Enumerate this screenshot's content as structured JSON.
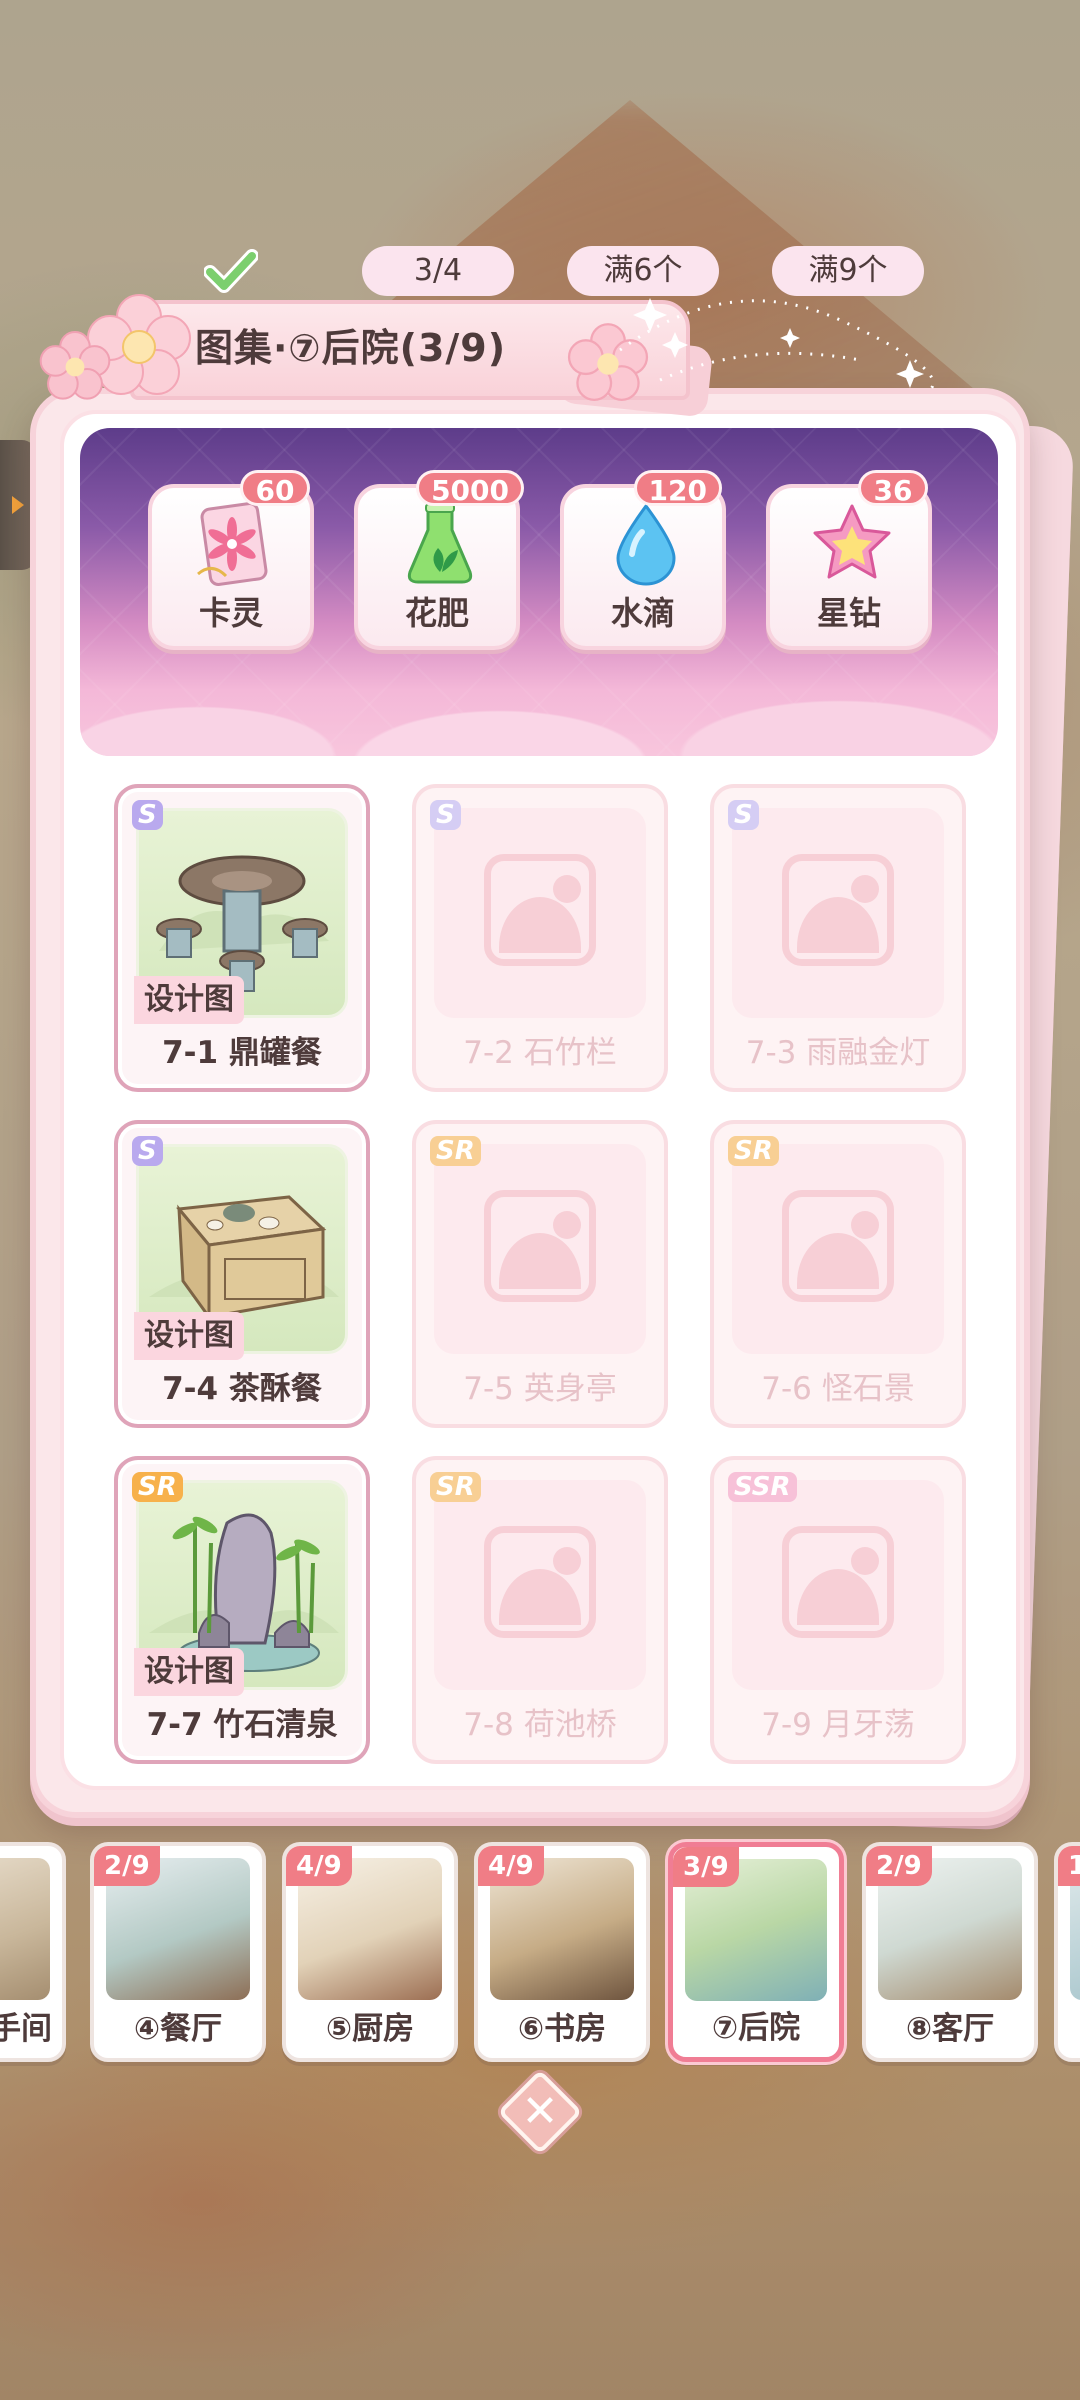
{
  "title": "图集·⑦后院(3/9)",
  "rewards": [
    {
      "name": "卡灵",
      "count": "60",
      "icon": "card-spirit-icon",
      "status": "",
      "claimed": true
    },
    {
      "name": "花肥",
      "count": "5000",
      "icon": "fertilizer-icon",
      "status": "3/4",
      "claimed": false
    },
    {
      "name": "水滴",
      "count": "120",
      "icon": "water-drop-icon",
      "status": "满6个",
      "claimed": false
    },
    {
      "name": "星钻",
      "count": "36",
      "icon": "star-diamond-icon",
      "status": "满9个",
      "claimed": false
    }
  ],
  "design_tag": "设计图",
  "items": [
    {
      "label": "7-1 鼎罐餐",
      "rarity": "S",
      "owned": true
    },
    {
      "label": "7-2 石竹栏",
      "rarity": "S",
      "owned": false
    },
    {
      "label": "7-3 雨融金灯",
      "rarity": "S",
      "owned": false
    },
    {
      "label": "7-4 茶酥餐",
      "rarity": "S",
      "owned": true
    },
    {
      "label": "7-5 英身亭",
      "rarity": "SR",
      "owned": false
    },
    {
      "label": "7-6 怪石景",
      "rarity": "SR",
      "owned": false
    },
    {
      "label": "7-7 竹石清泉",
      "rarity": "SR",
      "owned": true
    },
    {
      "label": "7-8 荷池桥",
      "rarity": "SR",
      "owned": false
    },
    {
      "label": "7-9 月牙荡",
      "rarity": "SSR",
      "owned": false
    }
  ],
  "rooms": [
    {
      "label": "手间",
      "progress": ""
    },
    {
      "label": "④餐厅",
      "progress": "2/9"
    },
    {
      "label": "⑤厨房",
      "progress": "4/9"
    },
    {
      "label": "⑥书房",
      "progress": "4/9"
    },
    {
      "label": "⑦后院",
      "progress": "3/9",
      "active": true
    },
    {
      "label": "⑧客厅",
      "progress": "2/9"
    },
    {
      "label": "",
      "progress": "1"
    }
  ],
  "close_icon": "close-icon",
  "colors": {
    "accent": "#f07d86",
    "panel": "#fbe7ea",
    "text": "#4e3b3b"
  }
}
